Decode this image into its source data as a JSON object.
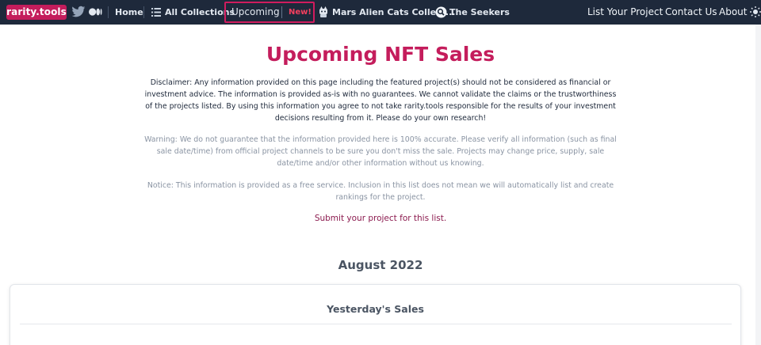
{
  "nav": {
    "logo": "rarity.tools",
    "home": "Home",
    "all_collections": "All Collections",
    "upcoming": "Upcoming",
    "new_badge": "New!",
    "featured_collection": "Mars Alien Cats Collect...",
    "seekers": "The Seekers",
    "list_project": "List Your Project",
    "contact": "Contact Us",
    "about": "About"
  },
  "icons": {
    "twitter": "twitter-icon",
    "medium": "medium-icon",
    "list": "list-icon",
    "cat": "alien-cat-icon",
    "seekers": "seekers-icon",
    "theme": "sun-icon"
  },
  "main": {
    "title": "Upcoming NFT Sales",
    "disclaimer": "Disclaimer: Any information provided on this page including the featured project(s) should not be considered as financial or investment advice. The information is provided as-is with no guarantees. We cannot validate the claims or the trustworthiness of the projects listed. By using this information you agree to not take rarity.tools responsible for the results of your investment decisions resulting from it. Please do your own research!",
    "warning": "Warning: We do not guarantee that the information provided here is 100% accurate. Please verify all information (such as final sale date/time) from official project channels to be sure you don't miss the sale. Projects may change price, supply, sale date/time and/or other information without us knowing.",
    "notice": "Notice: This information is provided as a free service. Inclusion in this list does not mean we will automatically list and create rankings for the project.",
    "submit_link": "Submit your project for this list.",
    "month": "August 2022",
    "card_title": "Yesterday's Sales"
  },
  "colors": {
    "brand": "#c41d5c",
    "nav_bg": "#1e293b",
    "link": "#8b1a4e"
  }
}
